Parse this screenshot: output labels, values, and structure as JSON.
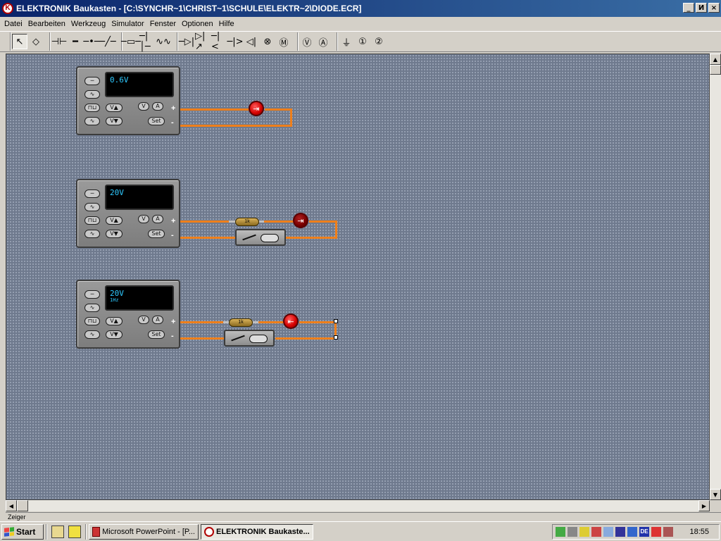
{
  "window": {
    "title": "ELEKTRONIK Baukasten - [C:\\SYNCHR~1\\CHRIST~1\\SCHULE\\ELEKTR~2\\DIODE.ECR]",
    "app_icon_glyph": "K",
    "controls": [
      "_",
      "И",
      "×"
    ]
  },
  "menu": [
    "Datei",
    "Bearbeiten",
    "Werkzeug",
    "Simulator",
    "Fenster",
    "Optionen",
    "Hilfe"
  ],
  "toolbar": {
    "groups": [
      [
        {
          "name": "pointer-tool-icon",
          "glyph": "↖",
          "active": true
        },
        {
          "name": "eraser-tool-icon",
          "glyph": "◇"
        }
      ],
      [
        {
          "name": "capacitor-tool-icon",
          "glyph": "⊣⊢"
        },
        {
          "name": "wire-tool-icon",
          "glyph": "━"
        },
        {
          "name": "junction-tool-icon",
          "glyph": "─•─"
        },
        {
          "name": "switch-tool-icon",
          "glyph": "─╱─"
        }
      ],
      [
        {
          "name": "resistor-tool-icon",
          "glyph": "─▭─"
        },
        {
          "name": "cell-tool-icon",
          "glyph": "─|│─"
        },
        {
          "name": "coil-tool-icon",
          "glyph": "∿∿"
        }
      ],
      [
        {
          "name": "diode-tool-icon",
          "glyph": "─▷|"
        },
        {
          "name": "led-tool-icon",
          "glyph": "▷|↗"
        },
        {
          "name": "transistor-npn-tool-icon",
          "glyph": "─|<"
        },
        {
          "name": "transistor-pnp-tool-icon",
          "glyph": "─|>"
        },
        {
          "name": "speaker-tool-icon",
          "glyph": "◁|"
        },
        {
          "name": "lamp-tool-icon",
          "glyph": "⊗"
        },
        {
          "name": "motor-tool-icon",
          "glyph": "Ⓜ"
        }
      ],
      [
        {
          "name": "voltmeter-tool-icon",
          "glyph": "Ⓥ"
        },
        {
          "name": "ammeter-tool-icon",
          "glyph": "Ⓐ"
        }
      ],
      [
        {
          "name": "ground-tool-icon",
          "glyph": "⏚"
        },
        {
          "name": "probe-1-tool-icon",
          "glyph": "①"
        },
        {
          "name": "probe-2-tool-icon",
          "glyph": "②"
        }
      ]
    ]
  },
  "power_supplies": [
    {
      "display_main": "0.6V",
      "display_sub": ""
    },
    {
      "display_main": "20V",
      "display_sub": ""
    },
    {
      "display_main": "20V",
      "display_sub": "1Hz"
    }
  ],
  "psu_buttons": {
    "dc": "─",
    "ac": "∿",
    "square": "⊓⊔",
    "sine": "∿",
    "v_up": "V▲",
    "v_down": "V▼",
    "volt": "V",
    "amp": "A",
    "set": "Set",
    "plus": "+",
    "minus": "-"
  },
  "resistor_label": "1k",
  "diode_glyph": "⇥",
  "diode_glyph_reverse": "⇤",
  "status": {
    "text": "Zeiger"
  },
  "taskbar": {
    "start_label": "Start",
    "tasks": [
      {
        "label": "Microsoft PowerPoint - [P...",
        "active": false
      },
      {
        "label": "ELEKTRONIK Baukaste...",
        "active": true
      }
    ],
    "tray_lang": "DE",
    "clock": "18:55"
  }
}
